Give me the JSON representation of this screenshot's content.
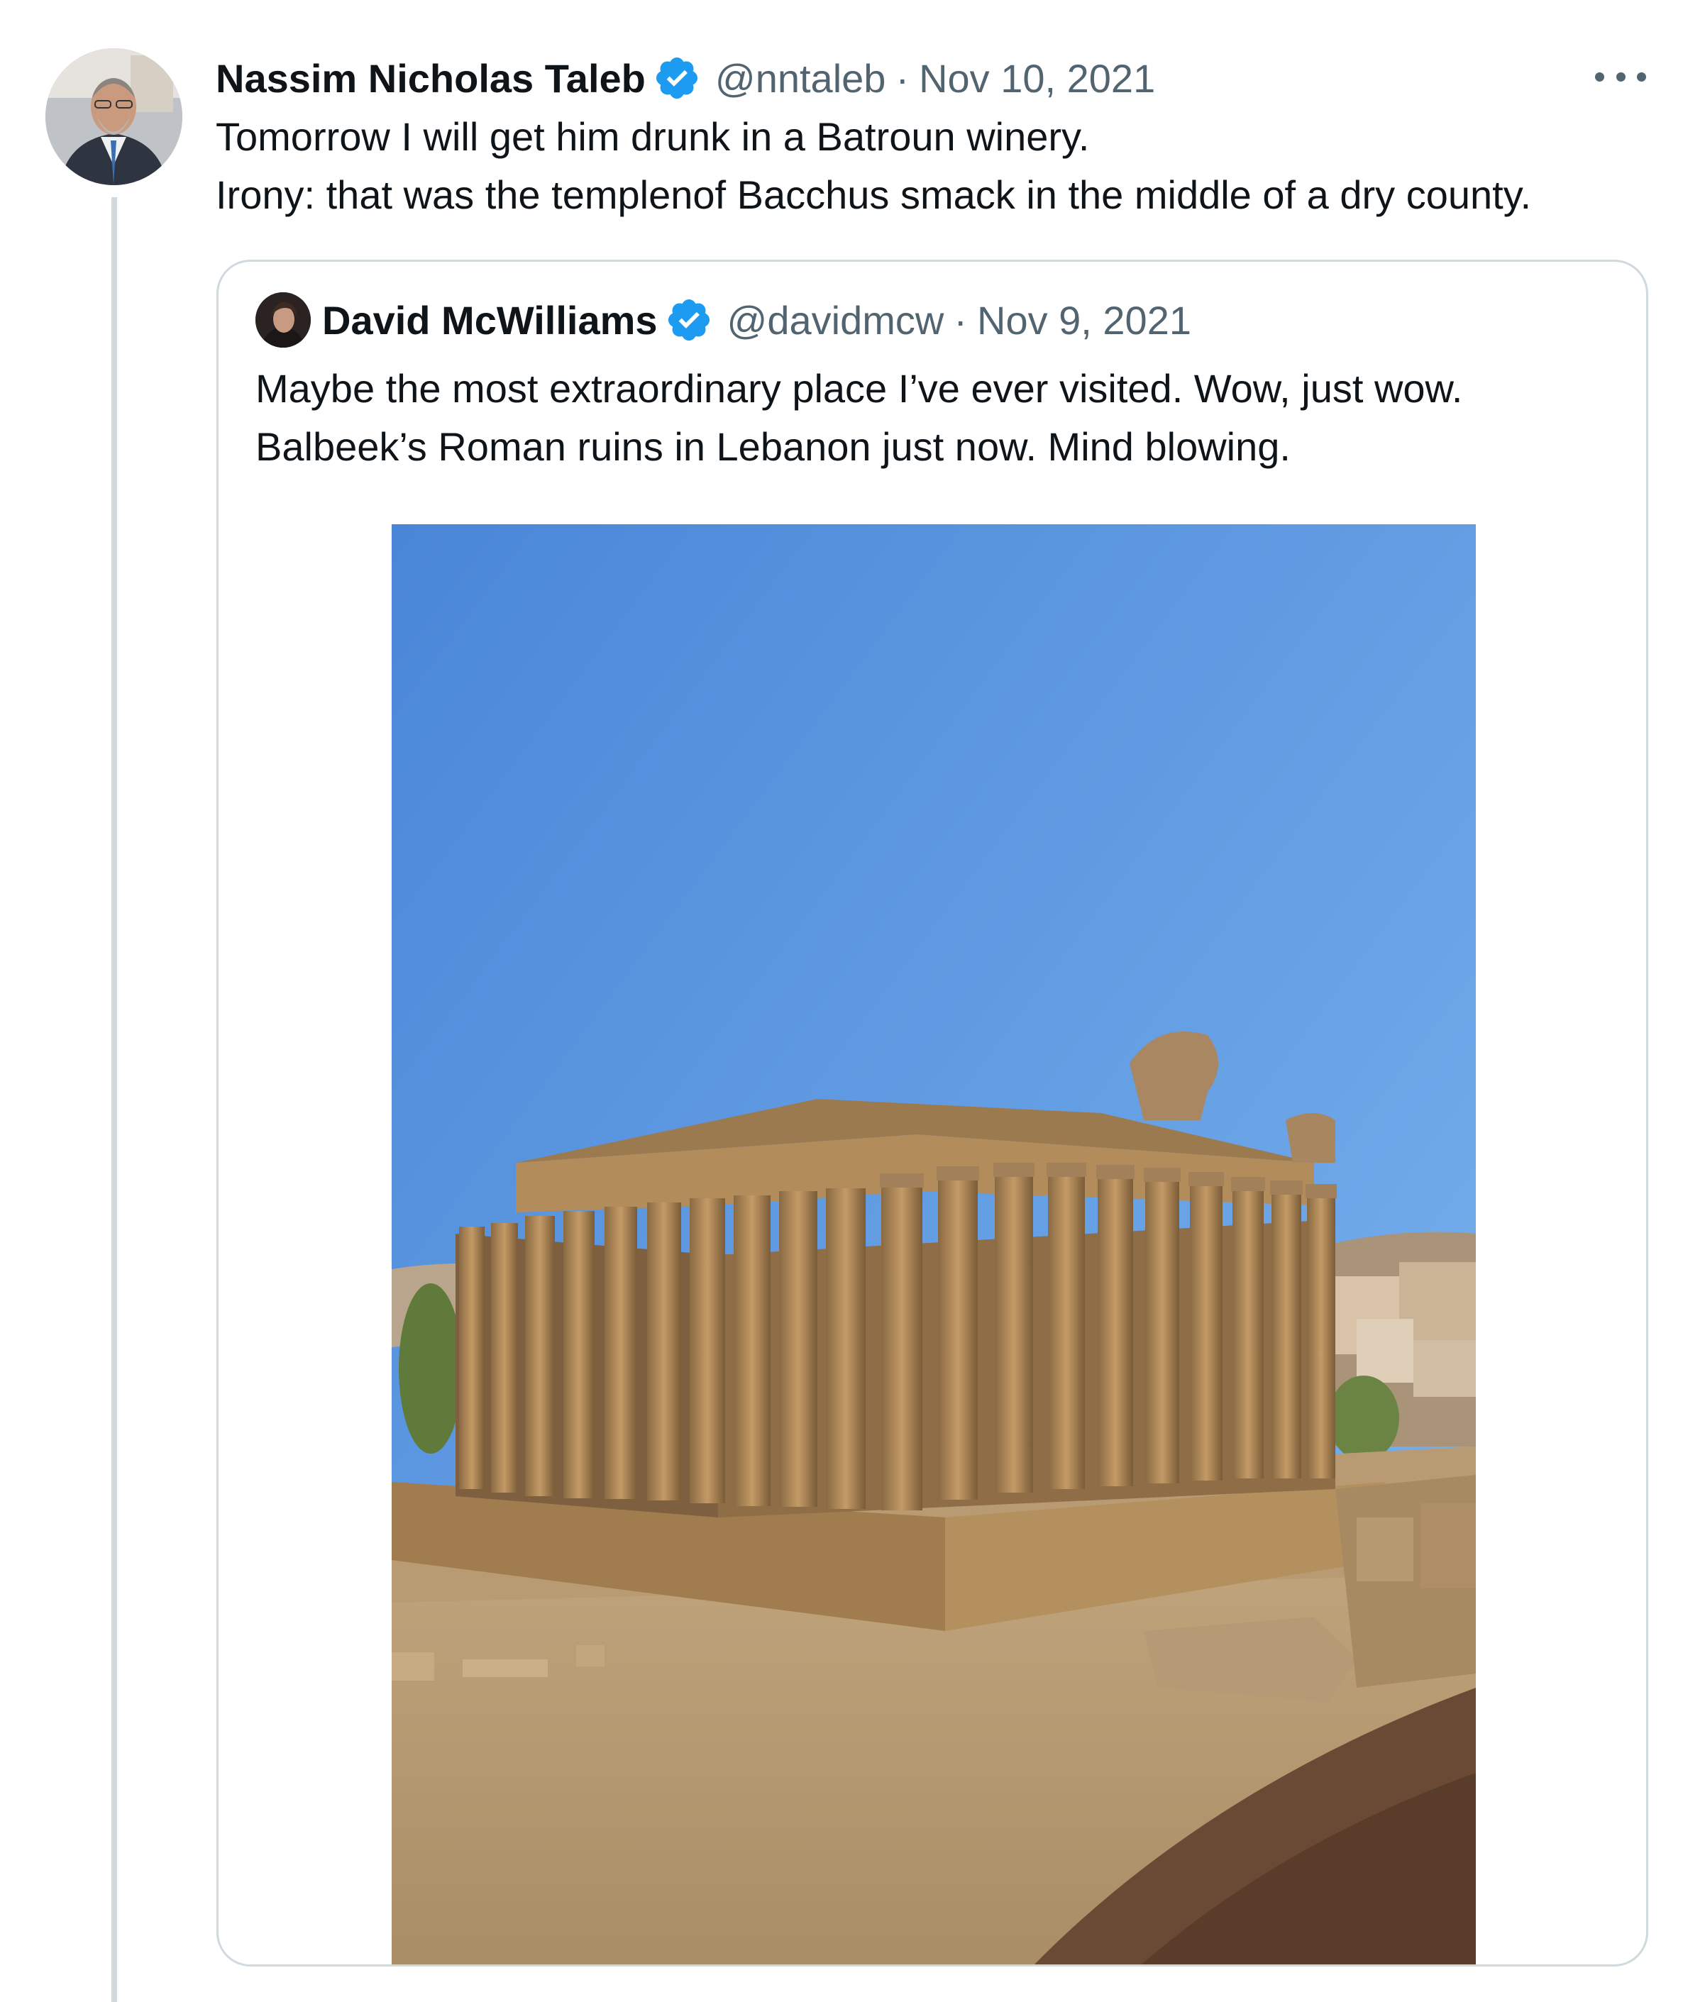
{
  "tweet": {
    "author": {
      "name": "Nassim Nicholas Taleb",
      "handle": "@nntaleb",
      "verified": true,
      "avatar": "profile-photo"
    },
    "date": "Nov 10, 2021",
    "separator": "·",
    "text_lines": [
      "Tomorrow I will get him drunk in a Batroun winery.",
      "Irony: that was the templenof Bacchus smack in the middle of a dry county."
    ],
    "more_icon": "more-horizontal-icon"
  },
  "quoted_tweet": {
    "author": {
      "name": "David McWilliams",
      "handle": "@davidmcw",
      "verified": true,
      "avatar": "profile-photo"
    },
    "date": "Nov 9, 2021",
    "separator": "·",
    "text_lines": [
      "Maybe the most extraordinary place I’ve ever visited. Wow, just wow.",
      "Balbeek’s Roman ruins in Lebanon just now. Mind blowing."
    ],
    "media": {
      "type": "photo",
      "subject": "Roman temple ruins under clear blue sky"
    }
  },
  "colors": {
    "text": "#0f1419",
    "secondary": "#536471",
    "verified": "#1d9bf0",
    "border": "#cfd9de",
    "sky_top": "#4a86d8",
    "sky_bottom": "#7db6ef",
    "stone": "#b08a5c"
  }
}
